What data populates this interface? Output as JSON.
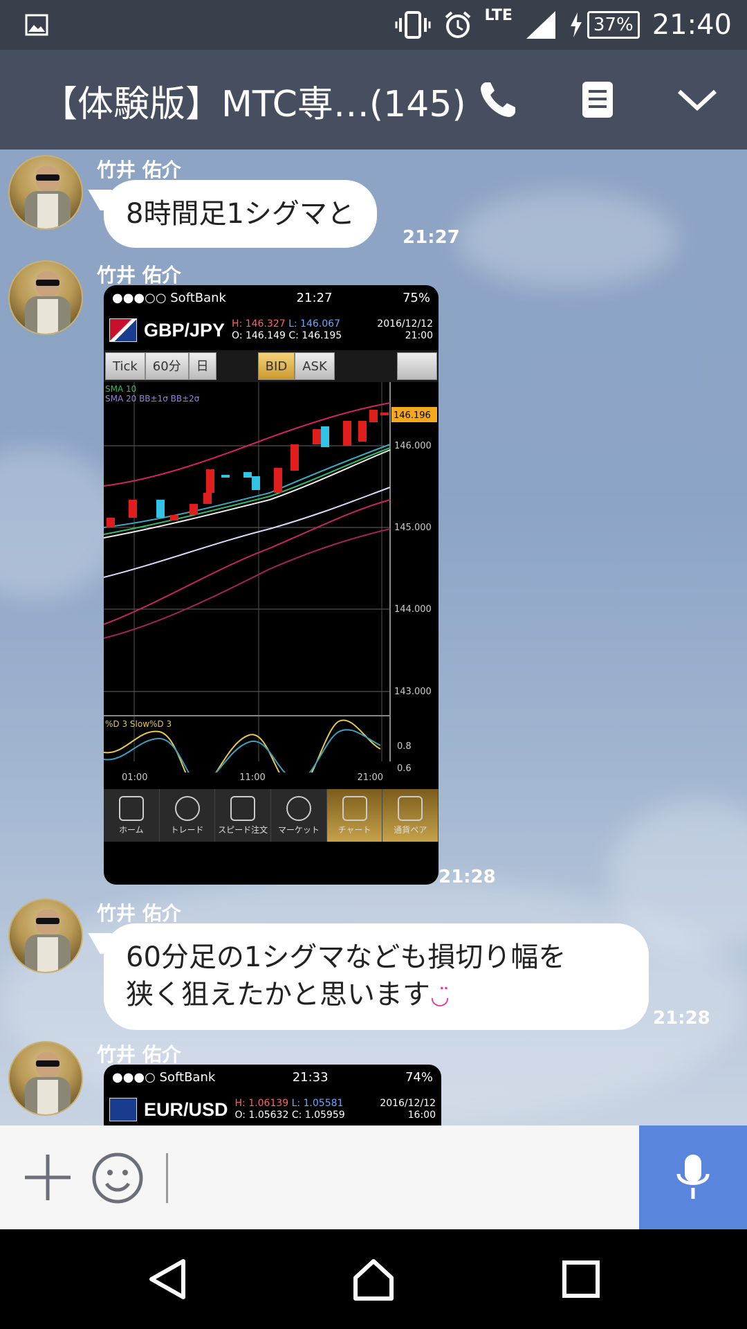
{
  "status_bar": {
    "time": "21:40",
    "battery": "37%",
    "network": "LTE"
  },
  "header": {
    "title": "【体験版】MTC専…(145)"
  },
  "messages": [
    {
      "sender": "竹井 佑介",
      "text": "8時間足1シグマと",
      "time": "21:27"
    },
    {
      "sender": "竹井 佑介",
      "time": "21:28",
      "image": {
        "carrier": "●●●○○ SoftBank",
        "clock": "21:27",
        "battery": "75%",
        "pair": "GBP/JPY",
        "h": "H: 146.327",
        "l": "L: 146.067",
        "o": "O: 146.149",
        "c": "C: 146.195",
        "date": "2016/12/12",
        "hour": "21:00",
        "tabs": [
          "Tick",
          "60分",
          "日",
          "BID",
          "ASK"
        ],
        "legend1": "SMA 10",
        "legend2": "SMA 20  BB±1σ  BB±2σ",
        "price_label": "146.196",
        "price_ticks": [
          "146.000",
          "145.000",
          "144.000",
          "143.000"
        ],
        "osc_label": "%D 3  Slow%D 3",
        "osc_ticks": [
          "0.8",
          "0.6"
        ],
        "time_ticks": [
          "01:00",
          "11:00",
          "21:00"
        ],
        "bottom_bar": [
          "ホーム",
          "トレード",
          "スピード注文",
          "マーケット",
          "チャート",
          "通貨ペア"
        ]
      }
    },
    {
      "sender": "竹井 佑介",
      "text_line1": "60分足の1シグマなども損切り幅を",
      "text_line2": "狭く狙えたかと思います",
      "emoji": "◡̈",
      "time": "21:28"
    },
    {
      "sender": "竹井 佑介",
      "image": {
        "carrier": "●●●○ SoftBank",
        "clock": "21:33",
        "battery": "74%",
        "pair": "EUR/USD",
        "h": "H: 1.06139",
        "l": "L: 1.05581",
        "o": "O: 1.05632",
        "c": "C: 1.05959",
        "date": "2016/12/12",
        "hour": "16:00"
      }
    }
  ],
  "colors": {
    "header": "#474e60",
    "status": "#3a3f4c",
    "mic": "#5a85dc",
    "timestamp": "#ffffff"
  }
}
